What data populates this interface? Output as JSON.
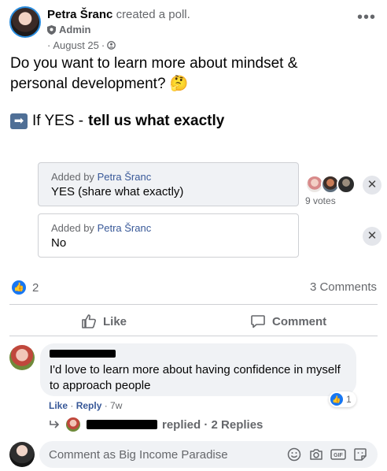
{
  "post": {
    "author": "Petra Šranc",
    "action": "created a poll.",
    "role": "Admin",
    "date": "August 25",
    "text_line1": "Do you want to learn more about mindset &",
    "text_line2": "personal development?",
    "emoji_thinking": "🤔",
    "line2_prefix": "If YES -",
    "line2_bold": "tell us what exactly"
  },
  "poll": {
    "options": [
      {
        "added_by_prefix": "Added by",
        "added_by": "Petra Šranc",
        "label": "YES (share what exactly)"
      },
      {
        "added_by_prefix": "Added by",
        "added_by": "Petra Šranc",
        "label": "No"
      }
    ],
    "votes": "9 votes"
  },
  "stats": {
    "likes": "2",
    "comments": "3 Comments"
  },
  "actions": {
    "like": "Like",
    "comment": "Comment"
  },
  "comment": {
    "text": "I'd love to learn more about having confidence in myself to approach people",
    "reaction_count": "1",
    "like_label": "Like",
    "reply_label": "Reply",
    "age": "7w",
    "replies_text": "replied · 2 Replies"
  },
  "composer": {
    "placeholder": "Comment as Big Income Paradise"
  },
  "colors": {
    "accent": "#1877f2",
    "link": "#385898",
    "muted": "#65676b"
  }
}
